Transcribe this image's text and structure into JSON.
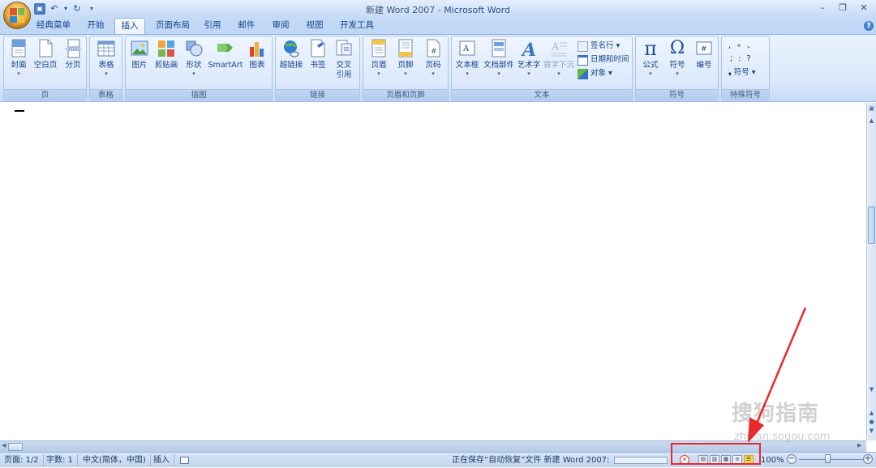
{
  "window": {
    "title_doc": "新建 Word 2007 - ",
    "title_app": "Microsoft Word"
  },
  "qat": {
    "save_icon": "save-icon",
    "undo": "↶",
    "redo": "↻",
    "dropdown": "▾"
  },
  "tabs": [
    "经典菜单",
    "开始",
    "插入",
    "页面布局",
    "引用",
    "邮件",
    "审阅",
    "视图",
    "开发工具"
  ],
  "active_tab": "插入",
  "help": "?",
  "ribbon": {
    "pages": {
      "label": "页",
      "buttons": [
        "封面",
        "空白页",
        "分页"
      ]
    },
    "table": {
      "label": "表格",
      "buttons": [
        "表格"
      ]
    },
    "illustrations": {
      "label": "插图",
      "buttons": [
        "图片",
        "剪贴画",
        "形状",
        "SmartArt",
        "图表"
      ]
    },
    "links": {
      "label": "链接",
      "buttons": [
        "超链接",
        "书签",
        "交叉",
        "引用"
      ]
    },
    "header_footer": {
      "label": "页眉和页脚",
      "buttons": [
        "页眉",
        "页脚",
        "页码"
      ]
    },
    "text": {
      "label": "文本",
      "buttons": [
        "文本框",
        "文档部件",
        "艺术字",
        "首字下沉"
      ],
      "small": [
        "签名行 ▾",
        "日期和时间",
        "对象 ▾"
      ]
    },
    "symbols": {
      "label": "符号",
      "buttons": [
        "公式",
        "符号",
        "编号"
      ]
    },
    "special": {
      "label": "特殊符号",
      "glyphs": [
        ", ∘ 、",
        ";  :  ?"
      ],
      "button": "符号 ▾"
    }
  },
  "status": {
    "page": "页面: 1/2",
    "words": "字数: 1",
    "language": "中文(简体，中国)",
    "mode": "插入",
    "saving": "正在保存“自动恢复”文件 新建 Word 2007:",
    "zoom": "100%",
    "zoom_minus": "−",
    "zoom_plus": "+"
  },
  "watermark": {
    "main": "搜狗指南",
    "sub": "zhinan.sogou.com"
  },
  "colors": {
    "highlight_box": "#e8292b",
    "active_view": "#f9d54a"
  }
}
